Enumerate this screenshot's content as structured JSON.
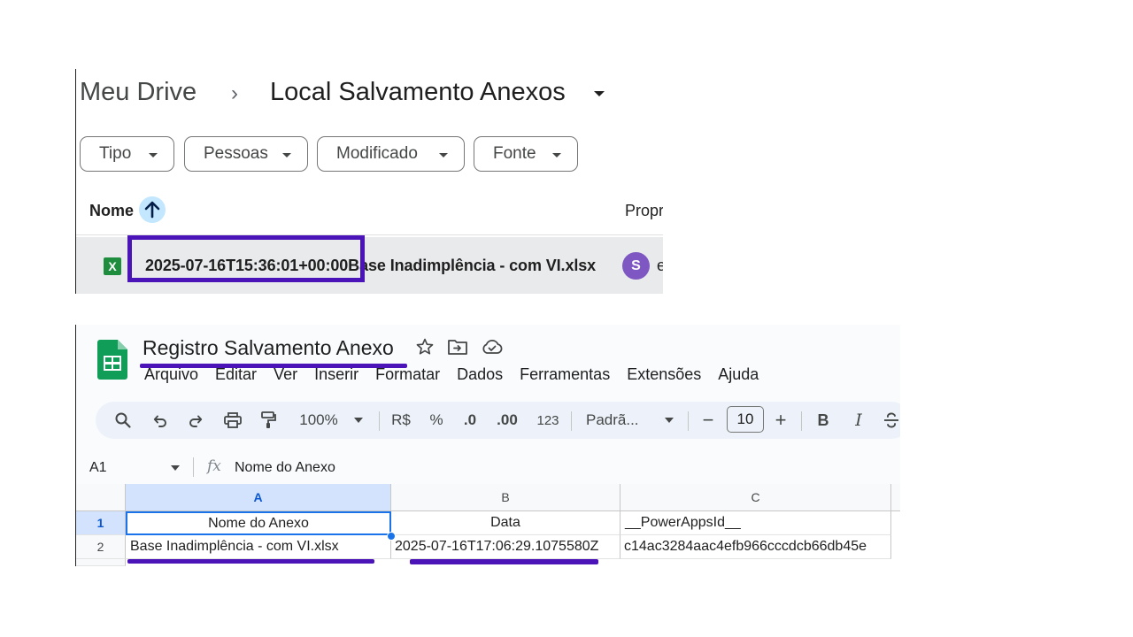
{
  "drive": {
    "breadcrumb_root": "Meu Drive",
    "breadcrumb_separator": "›",
    "breadcrumb_folder": "Local Salvamento Anexos",
    "filters": [
      {
        "label": "Tipo"
      },
      {
        "label": "Pessoas"
      },
      {
        "label": "Modificado"
      },
      {
        "label": "Fonte"
      }
    ],
    "columns": {
      "name": "Nome",
      "owner": "Propr"
    },
    "file": {
      "icon_letter": "X",
      "name": "2025-07-16T15:36:01+00:00Base Inadimplência - com VI.xlsx",
      "owner_initial": "S",
      "owner_trail": "e"
    }
  },
  "sheets": {
    "title": "Registro Salvamento Anexo",
    "menu": [
      "Arquivo",
      "Editar",
      "Ver",
      "Inserir",
      "Formatar",
      "Dados",
      "Ferramentas",
      "Extensões",
      "Ajuda"
    ],
    "toolbar": {
      "zoom": "100%",
      "currency": "R$",
      "percent": "%",
      "dec_decrease": ".0",
      "dec_increase": ".00",
      "number_format": "123",
      "font": "Padrã...",
      "minus": "−",
      "font_size": "10",
      "plus": "+",
      "bold": "B",
      "italic": "I"
    },
    "cell_ref": "A1",
    "fx": "fx",
    "formula_value": "Nome do Anexo",
    "columns": [
      "A",
      "B",
      "C"
    ],
    "rows": [
      {
        "num": "1",
        "cells": [
          "Nome do Anexo",
          "Data",
          "__PowerAppsId__"
        ]
      },
      {
        "num": "2",
        "cells": [
          "Base Inadimplência - com VI.xlsx",
          "2025-07-16T17:06:29.1075580Z",
          "c14ac3284aac4efb966cccdcb66db45e"
        ]
      }
    ]
  },
  "colors": {
    "highlight": "#4b14b8",
    "sheets_green": "#0f9d58",
    "selection": "#1a73e8"
  }
}
